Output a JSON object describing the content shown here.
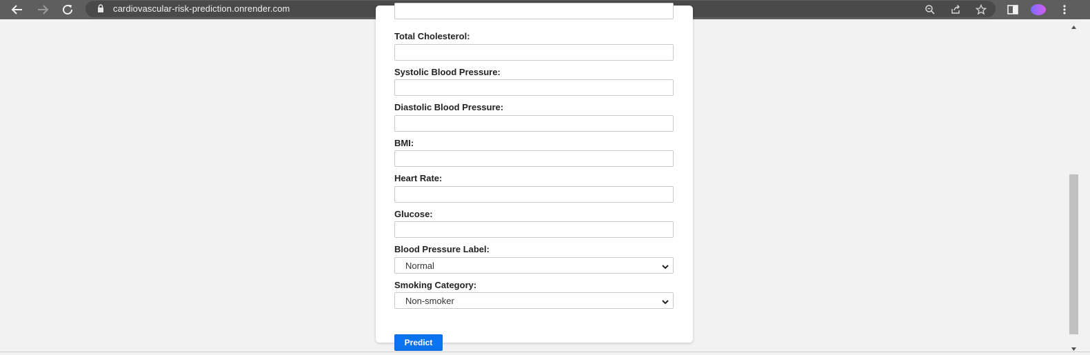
{
  "browser": {
    "url": "cardiovascular-risk-prediction.onrender.com",
    "icons": [
      "back-arrow-icon",
      "forward-arrow-icon",
      "reload-icon",
      "lock-icon",
      "zoom-icon",
      "share-icon",
      "bookmark-star-icon",
      "side-panel-icon",
      "profile-avatar",
      "more-menu-icon"
    ]
  },
  "form": {
    "fields": [
      {
        "label": "Total Cholesterol:",
        "value": ""
      },
      {
        "label": "Systolic Blood Pressure:",
        "value": ""
      },
      {
        "label": "Diastolic Blood Pressure:",
        "value": ""
      },
      {
        "label": "BMI:",
        "value": ""
      },
      {
        "label": "Heart Rate:",
        "value": ""
      },
      {
        "label": "Glucose:",
        "value": ""
      }
    ],
    "selects": [
      {
        "label": "Blood Pressure Label:",
        "value": "Normal"
      },
      {
        "label": "Smoking Category:",
        "value": "Non-smoker"
      }
    ],
    "submit_label": "Predict"
  },
  "colors": {
    "accent": "#0a74f0",
    "toolbar": "#5e5e5e",
    "page_bg": "#f2f2f2"
  }
}
